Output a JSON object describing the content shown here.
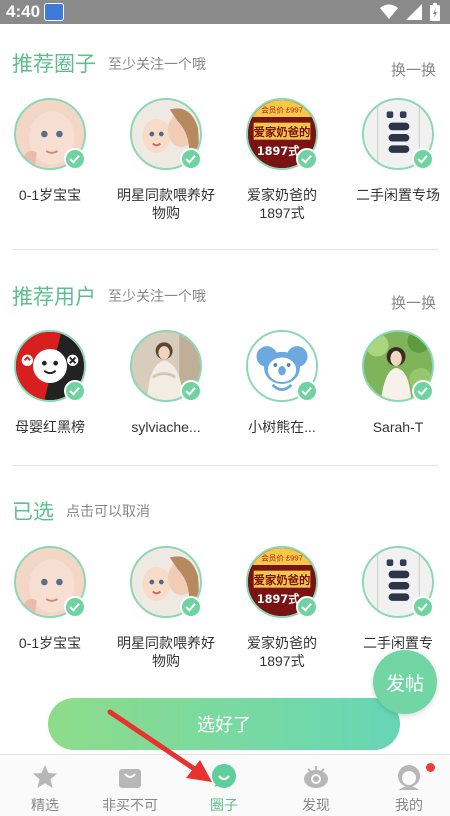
{
  "status_bar": {
    "time": "4:40"
  },
  "sections": {
    "recommended_circles": {
      "title": "推荐圈子",
      "subtitle": "至少关注一个哦",
      "refresh": "换一换"
    },
    "recommended_users": {
      "title": "推荐用户",
      "subtitle": "至少关注一个哦",
      "refresh": "换一换"
    },
    "selected": {
      "title": "已选",
      "subtitle": "点击可以取消"
    }
  },
  "circles": [
    {
      "label": "0-1岁宝宝"
    },
    {
      "label": "明星同款喂养好物购"
    },
    {
      "label": "爱家奶爸的1897式"
    },
    {
      "label": "二手闲置专场"
    }
  ],
  "users": [
    {
      "label": "母婴红黑榜"
    },
    {
      "label": "sylviache..."
    },
    {
      "label": "小树熊在..."
    },
    {
      "label": "Sarah-T"
    }
  ],
  "selected_items": [
    {
      "label": "0-1岁宝宝"
    },
    {
      "label": "明星同款喂养好物购"
    },
    {
      "label": "爱家奶爸的1897式"
    },
    {
      "label": "二手闲置专"
    }
  ],
  "thumb_text": {
    "dad_banner": "爱家奶爸的",
    "dad_year": "1897式",
    "dad_price": "会员价 £997"
  },
  "buttons": {
    "post": "发帖",
    "done": "选好了"
  },
  "tabs": [
    {
      "label": "精选",
      "icon": "star-icon"
    },
    {
      "label": "非买不可",
      "icon": "bag-icon"
    },
    {
      "label": "圈子",
      "icon": "chat-bubble-icon",
      "active": true
    },
    {
      "label": "发现",
      "icon": "eye-icon"
    },
    {
      "label": "我的",
      "icon": "profile-icon",
      "badge": true
    }
  ],
  "colors": {
    "accent": "#5dbf8f",
    "check": "#6fd3a1",
    "badge": "#ee3b3b",
    "arrow": "#e8322e"
  }
}
